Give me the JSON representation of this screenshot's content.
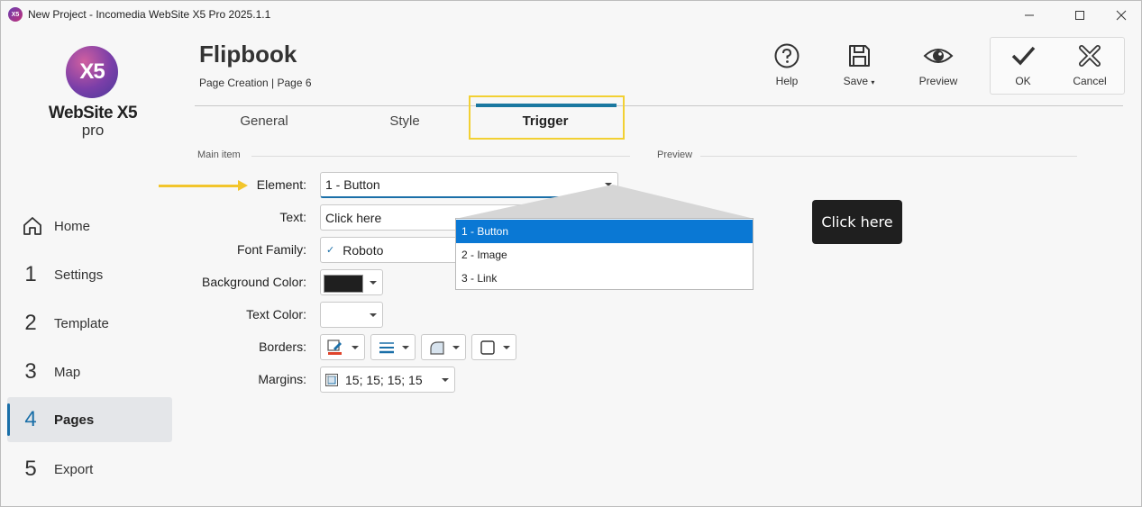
{
  "window": {
    "title": "New Project - Incomedia WebSite X5 Pro 2025.1.1",
    "app_icon_label": "X5",
    "controls": [
      "minimize",
      "maximize",
      "close"
    ]
  },
  "logo": {
    "mark": "X5",
    "name": "WebSite X5",
    "edition": "pro"
  },
  "sidebar": {
    "items": [
      {
        "num": "",
        "label": "Home",
        "icon": "home-icon"
      },
      {
        "num": "1",
        "label": "Settings"
      },
      {
        "num": "2",
        "label": "Template"
      },
      {
        "num": "3",
        "label": "Map"
      },
      {
        "num": "4",
        "label": "Pages",
        "active": true
      },
      {
        "num": "5",
        "label": "Export"
      }
    ]
  },
  "header": {
    "title": "Flipbook",
    "breadcrumb": "Page Creation | Page 6"
  },
  "toolbar": {
    "help": "Help",
    "save": "Save",
    "preview": "Preview",
    "ok": "OK",
    "cancel": "Cancel"
  },
  "tabs": [
    {
      "label": "General"
    },
    {
      "label": "Style"
    },
    {
      "label": "Trigger",
      "active": true
    }
  ],
  "sections": {
    "main_item": "Main item",
    "preview": "Preview"
  },
  "form": {
    "element_label": "Element:",
    "element_value": "1 - Button",
    "text_label": "Text:",
    "text_value": "Click here",
    "font_family_label": "Font Family:",
    "font_family_value": "Roboto",
    "background_color_label": "Background Color:",
    "background_color_value": "#1f1f1f",
    "text_color_label": "Text Color:",
    "text_color_value": "#ffffff",
    "borders_label": "Borders:",
    "margins_label": "Margins:",
    "margins_value": "15; 15; 15; 15"
  },
  "element_dropdown": {
    "options": [
      "1 - Button",
      "2 - Image",
      "3 - Link"
    ],
    "selected": "1 - Button"
  },
  "preview": {
    "button_text": "Click here"
  },
  "colors": {
    "accent": "#1a6fa8",
    "highlight": "#f2d033",
    "selection": "#0a78d4"
  }
}
